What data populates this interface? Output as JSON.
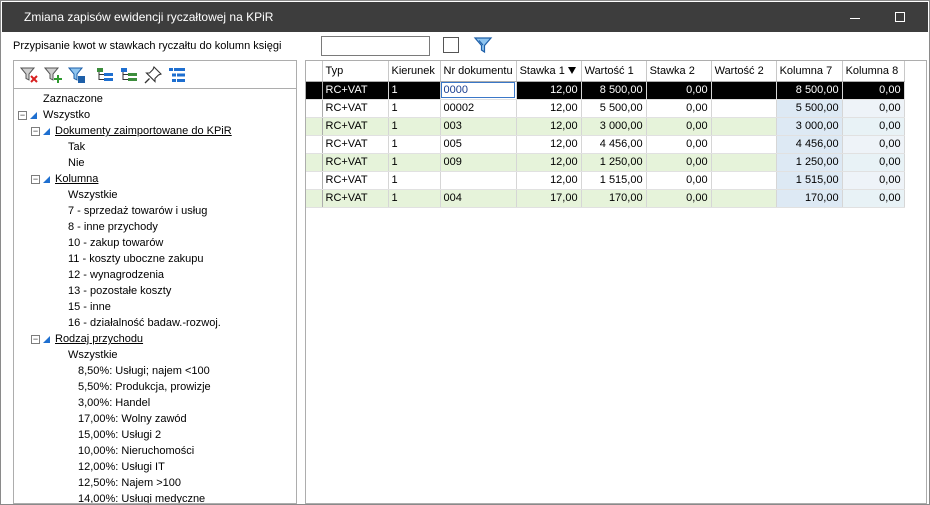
{
  "window": {
    "title": "Zmiana zapisów ewidencji ryczałtowej na KPiR"
  },
  "assign": {
    "label": "Przypisanie kwot w stawkach ryczałtu do kolumn księgi",
    "value": ""
  },
  "toolbar": {
    "icons": [
      "clear-filter-icon",
      "add-filter-icon",
      "edit-filter-icon",
      "expand-tree-icon",
      "collapse-tree-icon",
      "pin-icon",
      "list-view-icon"
    ]
  },
  "tree": {
    "selected": "Zaznaczone",
    "all": "Wszystko",
    "imported": {
      "label": "Dokumenty zaimportowane do KPiR",
      "items": [
        "Tak",
        "Nie"
      ]
    },
    "column": {
      "label": "Kolumna",
      "items": [
        "Wszystkie",
        "7   - sprzedaż towarów i usług",
        "8   - inne przychody",
        "10 - zakup towarów",
        "11 - koszty uboczne zakupu",
        "12 - wynagrodzenia",
        "13 - pozostałe koszty",
        "15 - inne",
        "16 - działalność badaw.-rozwoj."
      ]
    },
    "revenue": {
      "label": "Rodzaj przychodu",
      "all": "Wszystkie",
      "items": [
        "8,50%: Usługi; najem <100",
        "5,50%: Produkcja, prowizje",
        "3,00%: Handel",
        "17,00%: Wolny zawód",
        "15,00%: Usługi 2",
        "10,00%: Nieruchomości",
        "12,00%: Usługi IT",
        "12,50%: Najem >100",
        "14,00%: Usługi medyczne"
      ]
    }
  },
  "grid": {
    "columns": [
      "Typ",
      "Kierunek",
      "Nr dokumentu",
      "Stawka 1",
      "Wartość 1",
      "Stawka 2",
      "Wartość 2",
      "Kolumna 7",
      "Kolumna 8"
    ],
    "rows": [
      {
        "typ": "RC+VAT",
        "kierunek": "1",
        "nr": "0000",
        "stawka1": "12,00",
        "wartosc1": "8 500,00",
        "stawka2": "0,00",
        "wartosc2": "",
        "kol7": "8 500,00",
        "kol8": "0,00"
      },
      {
        "typ": "RC+VAT",
        "kierunek": "1",
        "nr": "00002",
        "stawka1": "12,00",
        "wartosc1": "5 500,00",
        "stawka2": "0,00",
        "wartosc2": "",
        "kol7": "5 500,00",
        "kol8": "0,00"
      },
      {
        "typ": "RC+VAT",
        "kierunek": "1",
        "nr": "003",
        "stawka1": "12,00",
        "wartosc1": "3 000,00",
        "stawka2": "0,00",
        "wartosc2": "",
        "kol7": "3 000,00",
        "kol8": "0,00"
      },
      {
        "typ": "RC+VAT",
        "kierunek": "1",
        "nr": "005",
        "stawka1": "12,00",
        "wartosc1": "4 456,00",
        "stawka2": "0,00",
        "wartosc2": "",
        "kol7": "4 456,00",
        "kol8": "0,00"
      },
      {
        "typ": "RC+VAT",
        "kierunek": "1",
        "nr": "009",
        "stawka1": "12,00",
        "wartosc1": "1 250,00",
        "stawka2": "0,00",
        "wartosc2": "",
        "kol7": "1 250,00",
        "kol8": "0,00"
      },
      {
        "typ": "RC+VAT",
        "kierunek": "1",
        "nr": "",
        "stawka1": "12,00",
        "wartosc1": "1 515,00",
        "stawka2": "0,00",
        "wartosc2": "",
        "kol7": "1 515,00",
        "kol8": "0,00"
      },
      {
        "typ": "RC+VAT",
        "kierunek": "1",
        "nr": "004",
        "stawka1": "17,00",
        "wartosc1": "170,00",
        "stawka2": "0,00",
        "wartosc2": "",
        "kol7": "170,00",
        "kol8": "0,00"
      }
    ]
  },
  "colors": {
    "titlebar": "#3d3d3d",
    "row_selected": "#000000",
    "row_alt": "#e6f3da",
    "tree_accent": "#1e6fd0"
  }
}
